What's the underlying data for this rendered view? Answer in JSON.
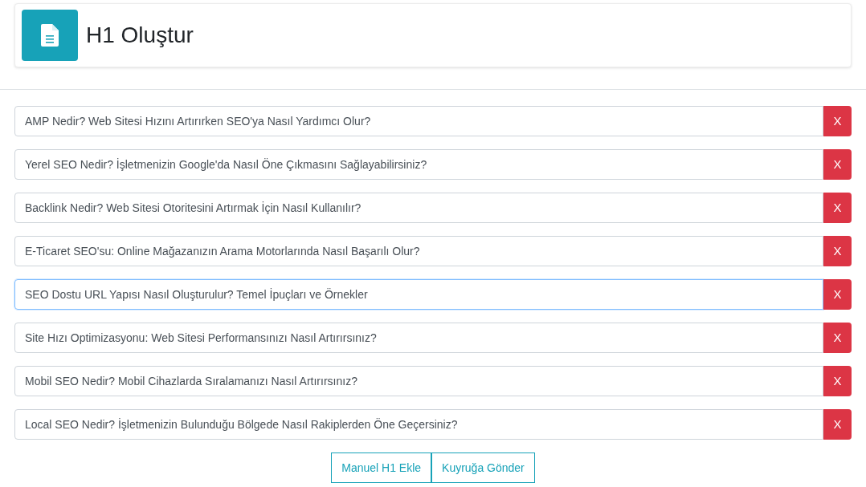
{
  "header": {
    "title": "H1 Oluştur"
  },
  "rows": [
    {
      "value": "AMP Nedir? Web Sitesi Hızını Artırırken SEO'ya Nasıl Yardımcı Olur?",
      "focused": false,
      "remove_label": "X"
    },
    {
      "value": "Yerel SEO Nedir? İşletmenizin Google'da Nasıl Öne Çıkmasını Sağlayabilirsiniz?",
      "focused": false,
      "remove_label": "X"
    },
    {
      "value": "Backlink Nedir? Web Sitesi Otoritesini Artırmak İçin Nasıl Kullanılır?",
      "focused": false,
      "remove_label": "X"
    },
    {
      "value": "E-Ticaret SEO'su: Online Mağazanızın Arama Motorlarında Nasıl Başarılı Olur?",
      "focused": false,
      "remove_label": "X"
    },
    {
      "value": "SEO Dostu URL Yapısı Nasıl Oluşturulur? Temel İpuçları ve Örnekler",
      "focused": true,
      "remove_label": "X"
    },
    {
      "value": "Site Hızı Optimizasyonu: Web Sitesi Performansınızı Nasıl Artırırsınız?",
      "focused": false,
      "remove_label": "X"
    },
    {
      "value": "Mobil SEO Nedir? Mobil Cihazlarda Sıralamanızı Nasıl Artırırsınız?",
      "focused": false,
      "remove_label": "X"
    },
    {
      "value": "Local SEO Nedir? İşletmenizin Bulunduğu Bölgede Nasıl Rakiplerden Öne Geçersiniz?",
      "focused": false,
      "remove_label": "X"
    }
  ],
  "buttons": [
    "Manuel H1 Ekle",
    "Kuyruğa Gönder"
  ]
}
